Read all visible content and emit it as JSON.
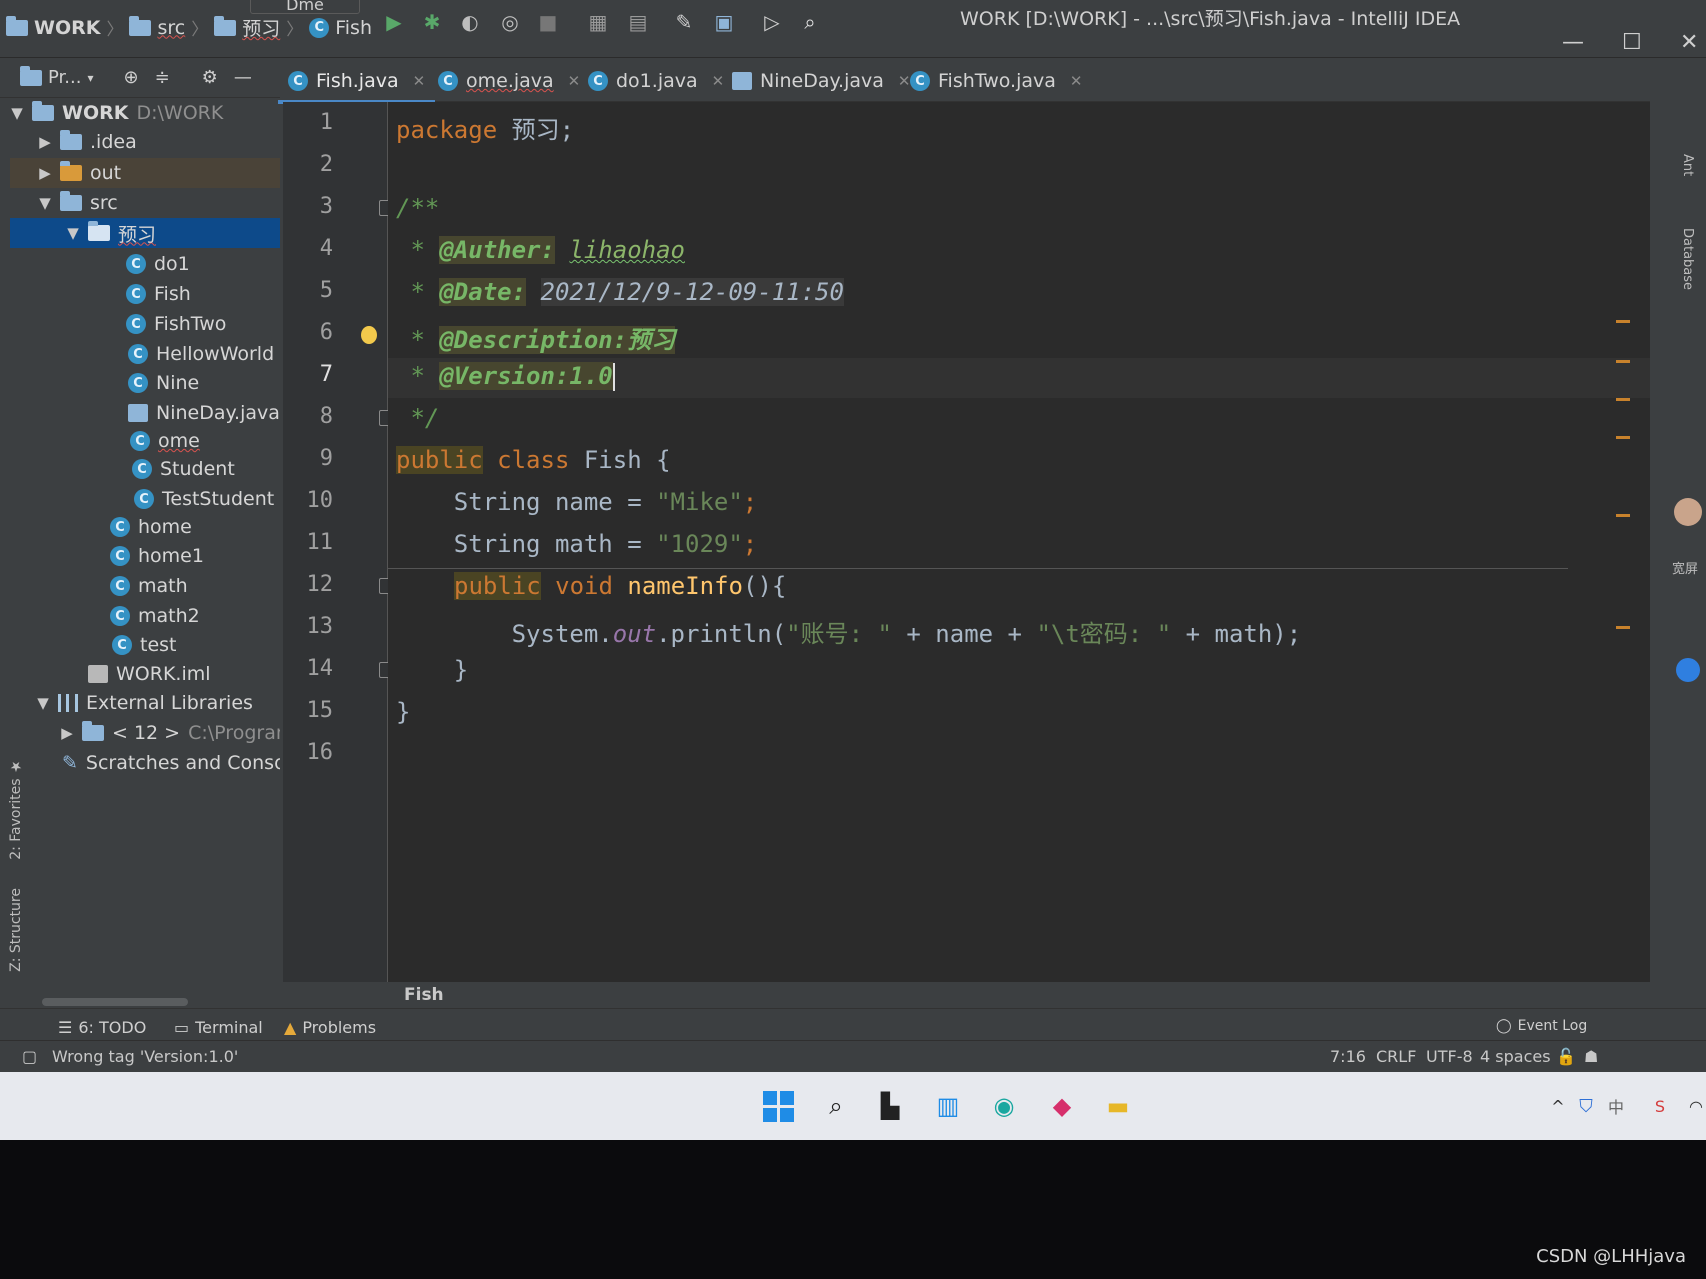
{
  "breadcrumb": {
    "project": "WORK",
    "folder1": "src",
    "folder2": "预习",
    "file": "Fish"
  },
  "window": {
    "run_config": "Dme",
    "title": "WORK [D:\\WORK] - ...\\src\\预习\\Fish.java - IntelliJ IDEA"
  },
  "project_panel": {
    "header_label": "Pr...",
    "tree": [
      {
        "label": "WORK",
        "path": "D:\\WORK",
        "kind": "module",
        "arrow": "▼"
      },
      {
        "label": ".idea",
        "kind": "folder",
        "arrow": "▶"
      },
      {
        "label": "out",
        "kind": "folder-orange",
        "arrow": "▶"
      },
      {
        "label": "src",
        "kind": "folder",
        "arrow": "▼"
      },
      {
        "label": "预习",
        "kind": "package",
        "arrow": "▼",
        "selected": true
      },
      {
        "label": "do1",
        "kind": "class"
      },
      {
        "label": "Fish",
        "kind": "class"
      },
      {
        "label": "FishTwo",
        "kind": "class"
      },
      {
        "label": "HellowWorld",
        "kind": "class"
      },
      {
        "label": "Nine",
        "kind": "class"
      },
      {
        "label": "NineDay.java",
        "kind": "file"
      },
      {
        "label": "ome",
        "kind": "class"
      },
      {
        "label": "Student",
        "kind": "class"
      },
      {
        "label": "TestStudent",
        "kind": "class"
      },
      {
        "label": "home",
        "kind": "class"
      },
      {
        "label": "home1",
        "kind": "class"
      },
      {
        "label": "math",
        "kind": "class"
      },
      {
        "label": "math2",
        "kind": "class"
      },
      {
        "label": "test",
        "kind": "class"
      },
      {
        "label": "WORK.iml",
        "kind": "file"
      },
      {
        "label": "External Libraries",
        "kind": "library",
        "arrow": "▼"
      },
      {
        "label": "< 12 >",
        "path": "C:\\Program I",
        "kind": "jdk",
        "arrow": "▶"
      },
      {
        "label": "Scratches and Consoles",
        "kind": "scratch"
      }
    ]
  },
  "side_tabs": {
    "favorites": "2: Favorites",
    "structure": "Z: Structure",
    "ant": "Ant",
    "database": "Database",
    "right_label": "宽屏"
  },
  "tabs": [
    {
      "label": "Fish.java",
      "active": true
    },
    {
      "label": "ome.java",
      "active": false
    },
    {
      "label": "do1.java",
      "active": false
    },
    {
      "label": "NineDay.java",
      "active": false
    },
    {
      "label": "FishTwo.java",
      "active": false
    }
  ],
  "editor": {
    "line_numbers": [
      "1",
      "2",
      "3",
      "4",
      "5",
      "6",
      "7",
      "8",
      "9",
      "10",
      "11",
      "12",
      "13",
      "14",
      "15",
      "16"
    ],
    "code": {
      "l1_kw": "package",
      "l1_rest": " 预习;",
      "l3": "/**",
      "l4_star": " * ",
      "l4_tag": "@Auther:",
      "l4_val": "lihaohao",
      "l5_star": " * ",
      "l5_tag": "@Date:",
      "l5_val": "2021/12/9-12-09-11:50",
      "l6_star": " * ",
      "l6_tag": "@Description:",
      "l6_val": "预习",
      "l7_star": " * ",
      "l7_tag": "@Version:1.0",
      "l8": " */",
      "l9_pub": "public",
      "l9_class": " class",
      "l9_rest": " Fish {",
      "l10_a": "    String name = ",
      "l10_str": "\"Mike\"",
      "l10_end": ";",
      "l11_a": "    String math = ",
      "l11_str": "\"1029\"",
      "l11_end": ";",
      "l12_pub": "public",
      "l12_void": " void",
      "l12_m": " nameInfo",
      "l12_rest": "(){",
      "l13_a": "        System.",
      "l13_out": "out",
      "l13_b": ".println(",
      "l13_s1": "\"账号: \"",
      "l13_c": " + name + ",
      "l13_s2": "\"\\t密码: \"",
      "l13_d": " + math);",
      "l14": "    }",
      "l15": "}"
    },
    "crumb": "Fish"
  },
  "tool_windows": {
    "todo": "6: TODO",
    "terminal": "Terminal",
    "problems": "Problems",
    "event_log": "Event Log"
  },
  "status_bar": {
    "message": "Wrong tag 'Version:1.0'",
    "position": "7:16",
    "line_sep": "CRLF",
    "encoding": "UTF-8",
    "indent": "4 spaces"
  },
  "monitor": {
    "watermark": "CSDN @LHHjava"
  },
  "colors": {
    "keyword": "#cc7832",
    "string": "#6a8759",
    "doc": "#629755",
    "selection": "#0d4a8a",
    "accent": "#4a88c7"
  }
}
